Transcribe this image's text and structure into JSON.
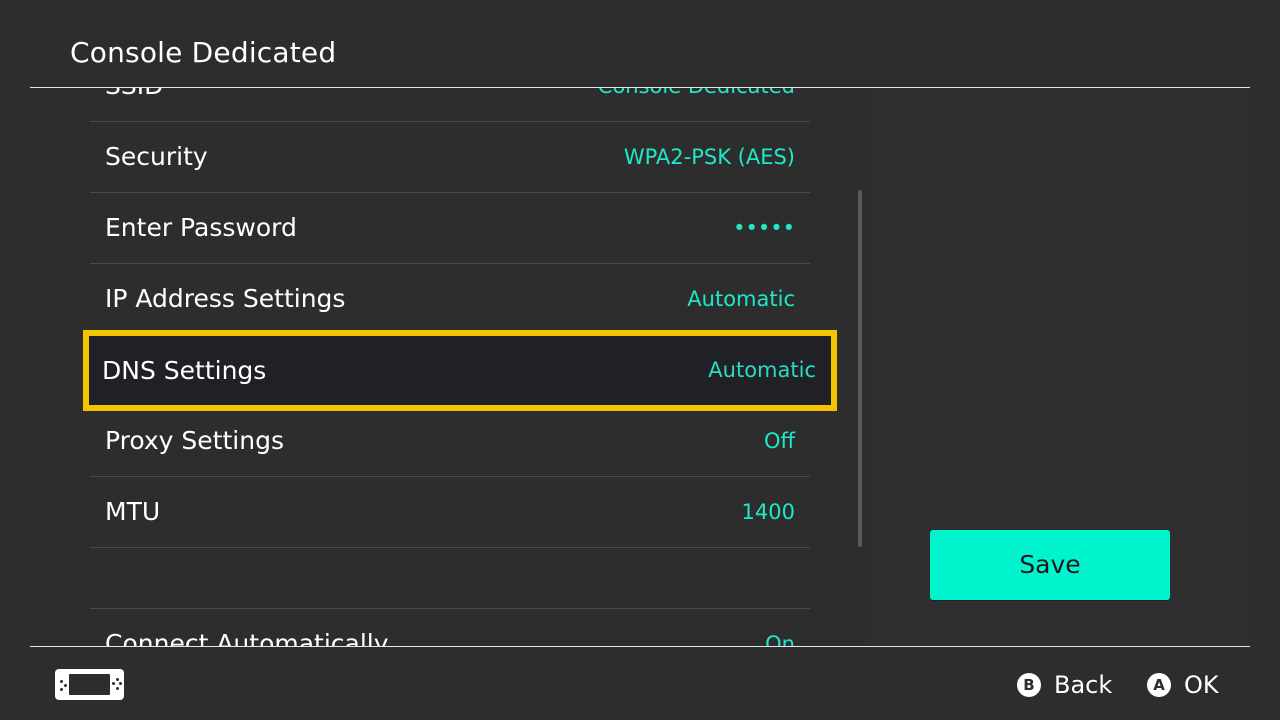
{
  "header": {
    "title": "Console Dedicated"
  },
  "settings": [
    {
      "label": "SSID",
      "value": "Console Dedicated"
    },
    {
      "label": "Security",
      "value": "WPA2-PSK (AES)"
    },
    {
      "label": "Enter Password",
      "value": "•••••"
    },
    {
      "label": "IP Address Settings",
      "value": "Automatic"
    },
    {
      "label": "DNS Settings",
      "value": "Automatic",
      "selected": true
    },
    {
      "label": "Proxy Settings",
      "value": "Off"
    },
    {
      "label": "MTU",
      "value": "1400"
    },
    {
      "label": "Connect Automatically",
      "value": "On"
    }
  ],
  "actions": {
    "save_label": "Save"
  },
  "footer": {
    "console_icon": "handheld-console-icon",
    "back": {
      "button": "B",
      "label": "Back"
    },
    "ok": {
      "button": "A",
      "label": "OK"
    }
  },
  "colors": {
    "background": "#2d2d2d",
    "value_text": "#1de9c8",
    "selection_border": "#f5c400",
    "save_button": "#00f5cf"
  }
}
